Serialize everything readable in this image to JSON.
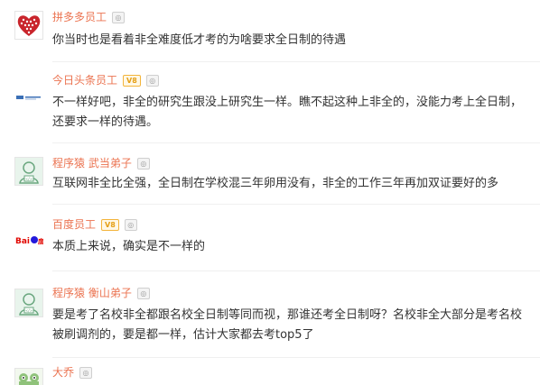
{
  "comments": [
    {
      "author": "拼多多员工",
      "level": "",
      "text": "你当时也是看着非全难度低才考的为啥要求全日制的待遇",
      "avatar_icon": "heart-pattern-avatar-icon"
    },
    {
      "author": "今日头条员工",
      "badge": "V8",
      "level": "",
      "text": "不一样好吧，非全的研究生跟没上研究生一样。瞧不起这种上非全的，没能力考上全日制，还要求一样的待遇。",
      "avatar_icon": "toutiao-logo-avatar-icon"
    },
    {
      "author": "程序猿 武当弟子",
      "level": "",
      "text": "互联网非全比全强，全日制在学校混三年卵用没有，非全的工作三年再加双证要好的多",
      "avatar_icon": "programmer-avatar-icon"
    },
    {
      "author": "百度员工",
      "badge": "V8",
      "level": "",
      "text": "本质上来说，确实是不一样的",
      "avatar_icon": "baidu-logo-avatar-icon"
    },
    {
      "author": "程序猿 衡山弟子",
      "level": "",
      "text": "要是考了名校非全都跟名校全日制等同而视，那谁还考全日制呀？名校非全大部分是考名校被刷调剂的，要是都一样，估计大家都去考top5了",
      "avatar_icon": "programmer-avatar-icon"
    },
    {
      "author": "大乔",
      "level": "",
      "text": "",
      "avatar_icon": "frog-avatar-icon"
    }
  ],
  "colors": {
    "name": "#eb7350",
    "text": "#333333",
    "vip_border": "#f3b43b"
  }
}
